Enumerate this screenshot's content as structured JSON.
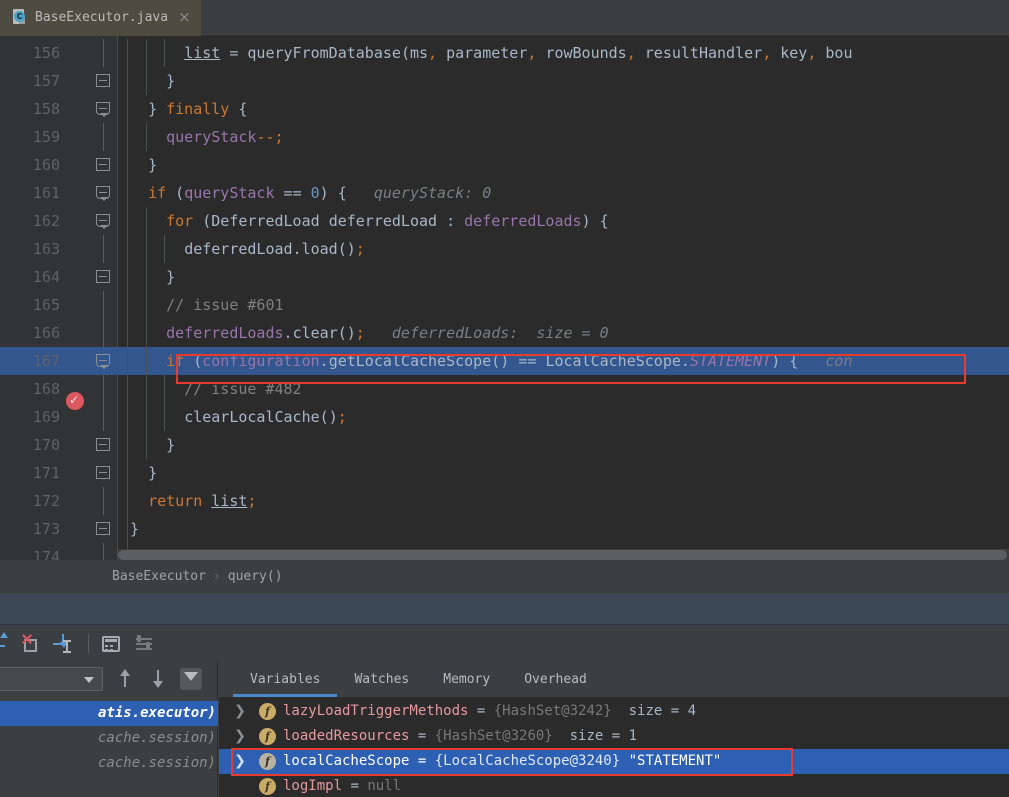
{
  "tab": {
    "filename": "BaseExecutor.java",
    "icon": "java-class-icon",
    "close": "×"
  },
  "editor": {
    "breadcrumb": {
      "class": "BaseExecutor",
      "separator": "›",
      "method": "query()"
    },
    "current_line": 167,
    "breakpoint_line": 167,
    "lines": [
      {
        "num": "156",
        "code": "      list = queryFromDatabase(ms, parameter, rowBounds, resultHandler, key, bou"
      },
      {
        "num": "157",
        "code": "    }"
      },
      {
        "num": "158",
        "code": "  } finally {"
      },
      {
        "num": "159",
        "code": "    queryStack--;"
      },
      {
        "num": "160",
        "code": "  }"
      },
      {
        "num": "161",
        "code": "  if (queryStack == 0) {",
        "hint": "queryStack: 0"
      },
      {
        "num": "162",
        "code": "    for (DeferredLoad deferredLoad : deferredLoads) {"
      },
      {
        "num": "163",
        "code": "      deferredLoad.load();"
      },
      {
        "num": "164",
        "code": "    }"
      },
      {
        "num": "165",
        "code": "    // issue #601"
      },
      {
        "num": "166",
        "code": "    deferredLoads.clear();",
        "hint": "deferredLoads:  size = 0"
      },
      {
        "num": "167",
        "code": "    if (configuration.getLocalCacheScope() == LocalCacheScope.STATEMENT) {",
        "hint": "con"
      },
      {
        "num": "168",
        "code": "      // issue #482"
      },
      {
        "num": "169",
        "code": "      clearLocalCache();"
      },
      {
        "num": "170",
        "code": "    }"
      },
      {
        "num": "171",
        "code": "  }"
      },
      {
        "num": "172",
        "code": "  return list;"
      },
      {
        "num": "173",
        "code": "}"
      },
      {
        "num": "174",
        "code": ""
      }
    ]
  },
  "debug_toolbar": {
    "icons": [
      {
        "name": "step-out-icon"
      },
      {
        "name": "force-step-into-icon"
      },
      {
        "name": "run-to-cursor-icon"
      },
      {
        "name": "evaluate-expression-icon"
      },
      {
        "name": "layout-settings-icon"
      }
    ]
  },
  "frames": {
    "thread_selector_value": "",
    "up_label": "↑",
    "down_label": "↓",
    "filter_label": "filter",
    "rows": [
      {
        "text": "atis.executor)",
        "selected": true
      },
      {
        "text": "cache.session)",
        "selected": false
      },
      {
        "text": "cache.session)",
        "selected": false
      }
    ]
  },
  "variables_panel": {
    "tabs": [
      {
        "label": "Variables",
        "active": true
      },
      {
        "label": "Watches",
        "active": false
      },
      {
        "label": "Memory",
        "active": false
      },
      {
        "label": "Overhead",
        "active": false
      }
    ],
    "rows": [
      {
        "expandable": true,
        "chevron": "❯",
        "icon": "field-icon",
        "name": "lazyLoadTriggerMethods",
        "eq": " = ",
        "ref": "{HashSet@3242}",
        "extra": "  size = 4",
        "selected": false
      },
      {
        "expandable": true,
        "chevron": "❯",
        "icon": "field-icon",
        "name": "loadedResources",
        "eq": " = ",
        "ref": "{HashSet@3260}",
        "extra": "  size = 1",
        "selected": false
      },
      {
        "expandable": true,
        "chevron": "❯",
        "icon": "field-icon",
        "name": "localCacheScope",
        "eq": " = ",
        "ref": "{LocalCacheScope@3240}",
        "extra": " \"STATEMENT\"",
        "selected": true
      },
      {
        "expandable": false,
        "chevron": "",
        "icon": "field-icon",
        "name": "logImpl",
        "eq": " = ",
        "ref": "null",
        "extra": "",
        "selected": false
      }
    ]
  },
  "annotations": [
    {
      "name": "code-highlight-box",
      "color": "#e83b2f"
    },
    {
      "name": "variable-highlight-box",
      "color": "#e83b2f"
    }
  ],
  "colors": {
    "editor_bg": "#2b2b2b",
    "panel_bg": "#3c3f41",
    "selection_blue": "#2d5fb3",
    "current_line_blue": "#33568f",
    "keyword_orange": "#cc7832",
    "field_purple": "#9876aa",
    "number_blue": "#6897bb",
    "comment_gray": "#808080",
    "annotation_red": "#e83b2f",
    "accent_blue": "#4a88c7"
  }
}
